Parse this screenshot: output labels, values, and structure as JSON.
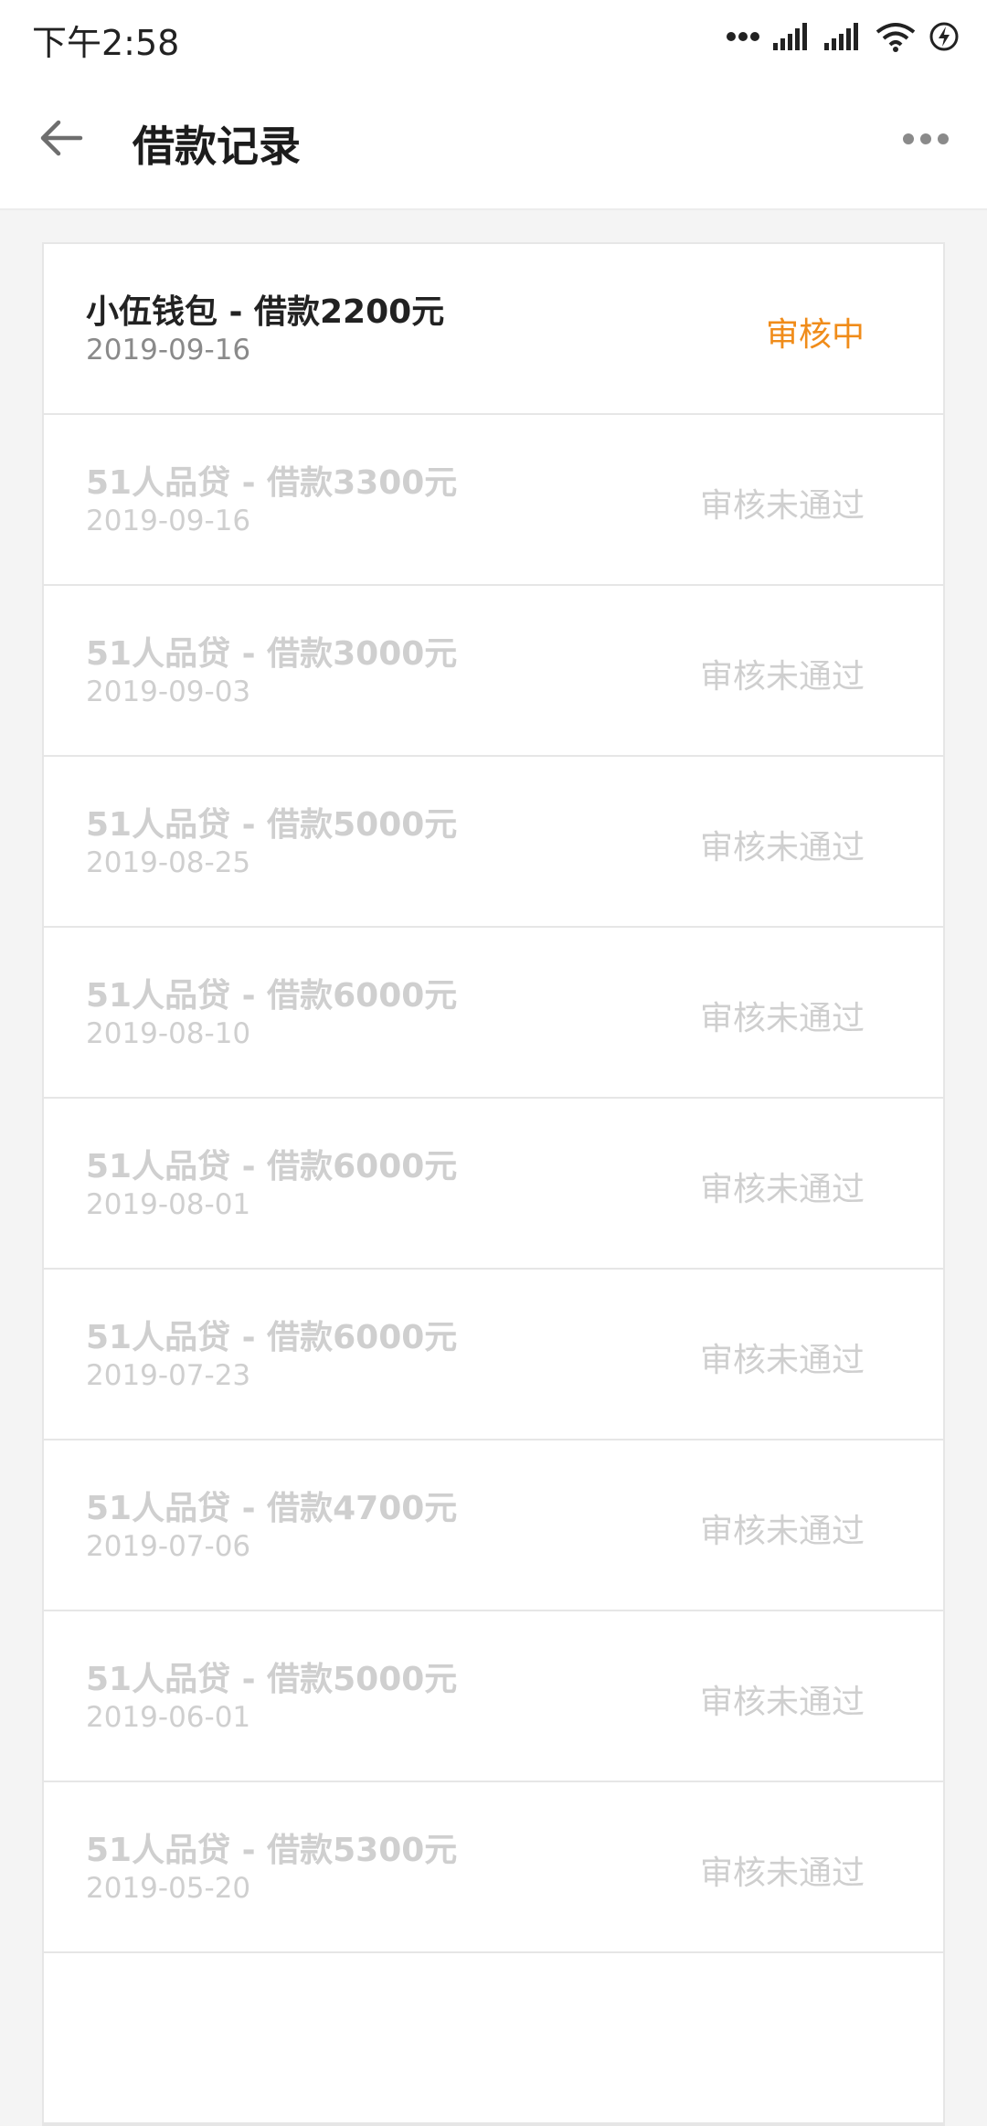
{
  "status_bar": {
    "time": "下午2:58",
    "icons": [
      "dots-icon",
      "signal-icon",
      "signal-icon",
      "wifi-icon",
      "charging-icon"
    ]
  },
  "page_load_progress": 0.22,
  "header": {
    "title": "借款记录",
    "back_icon": "arrow-left-icon",
    "more_icon": "more-horizontal-icon"
  },
  "colors": {
    "progress_bar": "#5fc233",
    "pending_status": "#f08c1a",
    "disabled_text": "#cfcfcf",
    "background": "#f4f4f4"
  },
  "records": [
    {
      "title": "小伍钱包 - 借款2200元",
      "date": "2019-09-16",
      "status": "审核中",
      "state": "pending"
    },
    {
      "title": "51人品贷 - 借款3300元",
      "date": "2019-09-16",
      "status": "审核未通过",
      "state": "rejected"
    },
    {
      "title": "51人品贷 - 借款3000元",
      "date": "2019-09-03",
      "status": "审核未通过",
      "state": "rejected"
    },
    {
      "title": "51人品贷 - 借款5000元",
      "date": "2019-08-25",
      "status": "审核未通过",
      "state": "rejected"
    },
    {
      "title": "51人品贷 - 借款6000元",
      "date": "2019-08-10",
      "status": "审核未通过",
      "state": "rejected"
    },
    {
      "title": "51人品贷 - 借款6000元",
      "date": "2019-08-01",
      "status": "审核未通过",
      "state": "rejected"
    },
    {
      "title": "51人品贷 - 借款6000元",
      "date": "2019-07-23",
      "status": "审核未通过",
      "state": "rejected"
    },
    {
      "title": "51人品贷 - 借款4700元",
      "date": "2019-07-06",
      "status": "审核未通过",
      "state": "rejected"
    },
    {
      "title": "51人品贷 - 借款5000元",
      "date": "2019-06-01",
      "status": "审核未通过",
      "state": "rejected"
    },
    {
      "title": "51人品贷 - 借款5300元",
      "date": "2019-05-20",
      "status": "审核未通过",
      "state": "rejected"
    }
  ]
}
